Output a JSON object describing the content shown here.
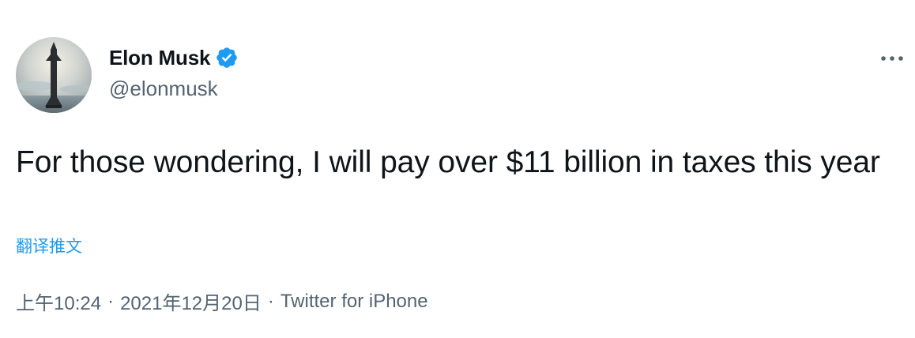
{
  "author": {
    "display_name": "Elon Musk",
    "handle": "@elonmusk",
    "verified": true,
    "avatar_icon": "starship-avatar-icon",
    "verified_icon": "verified-badge-icon"
  },
  "tweet": {
    "text": "For those wondering, I will pay over $11 billion in taxes this year",
    "translate_label": "翻译推文"
  },
  "meta": {
    "time": "上午10:24",
    "separator": "·",
    "date": "2021年12月20日",
    "source": "Twitter for iPhone"
  },
  "colors": {
    "text": "#0f1419",
    "secondary": "#536471",
    "accent": "#1d9bf0"
  },
  "more_icon": "more-options-icon"
}
